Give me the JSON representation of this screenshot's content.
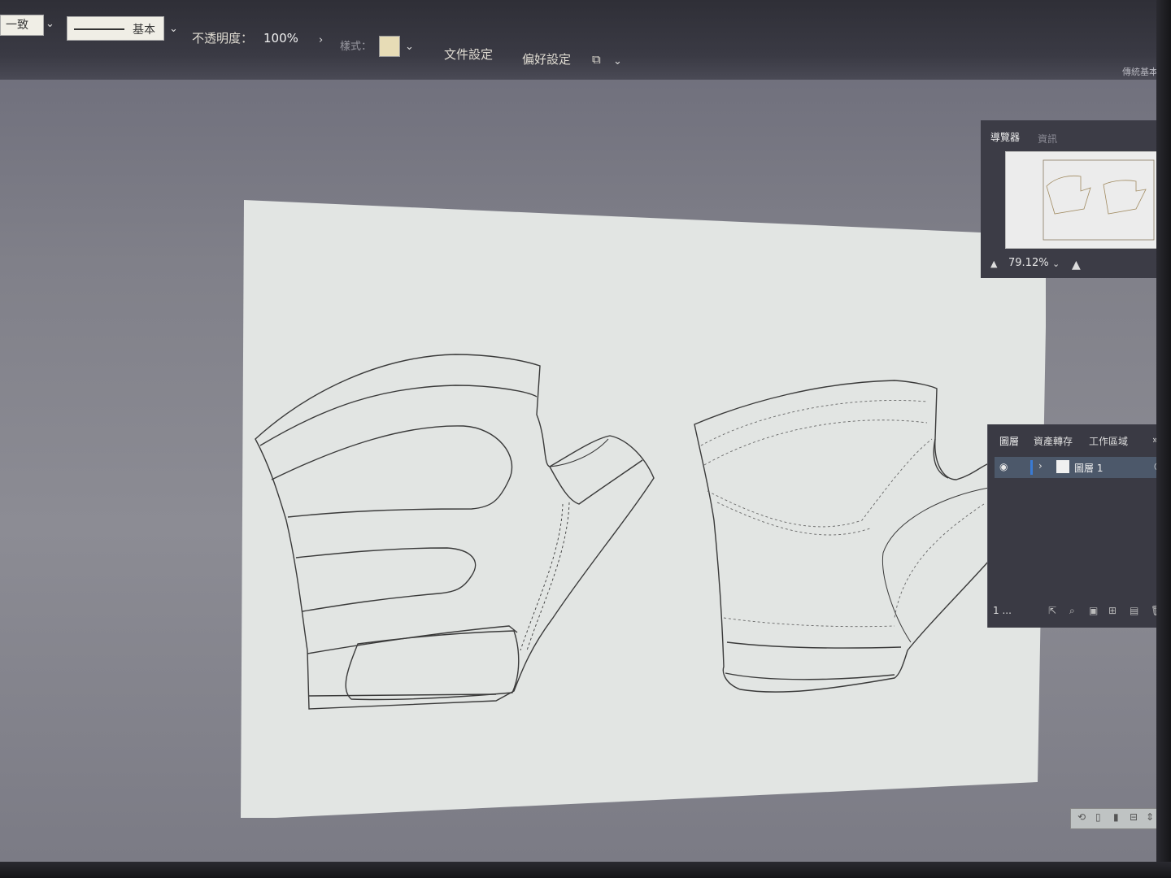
{
  "control_bar": {
    "align_value": "一致",
    "stroke_profile_label": "基本",
    "opacity_label": "不透明度：",
    "opacity_value": "100%",
    "style_label": "樣式：",
    "style_swatch_color": "#e7dcb6",
    "document_setup_button": "文件設定",
    "preferences_button": "偏好設定",
    "top_right_text": "傳統基本功能"
  },
  "navigator_panel": {
    "tab_active": "導覽器",
    "tab_inactive": "資訊",
    "zoom_value": "79.12%"
  },
  "layers_panel": {
    "tabs": [
      "圖層",
      "資產轉存",
      "工作區域"
    ],
    "layer_name": "圖層 1",
    "layer_count": "1 ..."
  }
}
